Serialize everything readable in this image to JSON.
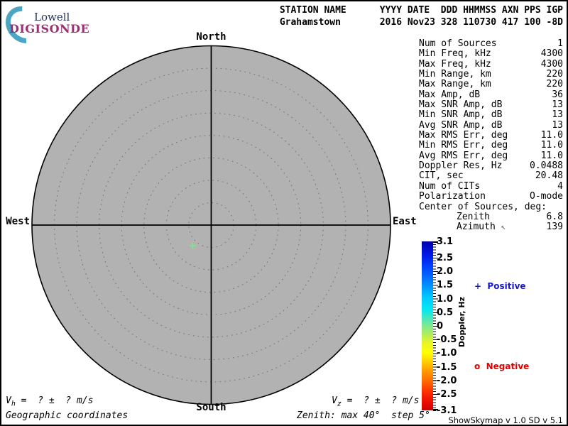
{
  "logo": {
    "line1": "Lowell",
    "line2": "DIGISONDE"
  },
  "header": {
    "line1": "STATION NAME      YYYY DATE  DDD HHMMSS AXN PPS IGP",
    "line2": "Grahamstown       2016 Nov23 328 110730 417 100 -8D"
  },
  "compass": {
    "north": "North",
    "south": "South",
    "east": "East",
    "west": "West"
  },
  "panel": {
    "azimuth_arrow": "↖",
    "rows": [
      {
        "label": "Num of Sources",
        "value": "1"
      },
      {
        "label": "Min Freq, kHz",
        "value": "4300"
      },
      {
        "label": "Max Freq, kHz",
        "value": "4300"
      },
      {
        "label": "Min Range, km",
        "value": "220"
      },
      {
        "label": "Max Range, km",
        "value": "220"
      },
      {
        "label": "Max Amp, dB",
        "value": "36"
      },
      {
        "label": "Max SNR Amp, dB",
        "value": "13"
      },
      {
        "label": "Min SNR Amp, dB",
        "value": "13"
      },
      {
        "label": "Avg SNR Amp, dB",
        "value": "13"
      },
      {
        "label": "Max RMS Err, deg",
        "value": "11.0"
      },
      {
        "label": "Min RMS Err, deg",
        "value": "11.0"
      },
      {
        "label": "Avg RMS Err, deg",
        "value": "11.0"
      },
      {
        "label": "Doppler Res, Hz",
        "value": "0.0488"
      },
      {
        "label": "CIT, sec",
        "value": "20.48"
      },
      {
        "label": "Num of CITs",
        "value": "4"
      },
      {
        "label": "Polarization",
        "value": "O-mode"
      },
      {
        "label": "Center of Sources, deg:",
        "value": ""
      },
      {
        "label": "Zenith",
        "value": "6.8"
      },
      {
        "label": "Azimuth",
        "value": "139"
      }
    ]
  },
  "colorbar": {
    "axis_label": "Doppler, Hz",
    "ticks": [
      "3.1",
      "2.5",
      "2.0",
      "1.5",
      "1.0",
      "0.5",
      "0",
      "-0.5",
      "-1.0",
      "-1.5",
      "-2.0",
      "-2.5",
      "-3.1"
    ],
    "positive_symbol": "+",
    "positive_label": "Positive",
    "negative_symbol": "o",
    "negative_label": "Negative"
  },
  "footer": {
    "vh_var": "V",
    "vh_sub": "h",
    "vh_rest": " =  ? ±  ? m/s",
    "vz_var": "V",
    "vz_sub": "z",
    "vz_rest": " =  ? ±  ? m/s",
    "geographic": "Geographic coordinates",
    "zenith_note": "Zenith: max 40°  step 5°",
    "version": "ShowSkymap v 1.0   SD v 5.1"
  },
  "chart_data": {
    "type": "scatter",
    "title": "Digisonde skymap, Grahamstown 2016 Nov23 328 110730",
    "projection": "polar-skymap",
    "compass_labels": [
      "North",
      "East",
      "South",
      "West"
    ],
    "zenith_max_deg": 40,
    "zenith_step_deg": 5,
    "zenith_rings_deg": [
      5,
      10,
      15,
      20,
      25,
      30,
      35,
      40
    ],
    "coordinates": "Geographic coordinates",
    "colorbar": {
      "label": "Doppler, Hz",
      "min": -3.1,
      "max": 3.1,
      "major_tick_step": 0.5,
      "tick_labels": [
        3.1,
        2.5,
        2.0,
        1.5,
        1.0,
        0.5,
        0,
        -0.5,
        -1.0,
        -1.5,
        -2.0,
        -2.5,
        -3.1
      ],
      "positive_color": "#1a1acd",
      "negative_color": "#e00000"
    },
    "points": [
      {
        "zenith_deg": 6.8,
        "azimuth_deg": 139,
        "doppler_hz": 0.1,
        "marker": "+",
        "polarity": "positive",
        "color": "#7de87d"
      }
    ],
    "num_points": 1
  }
}
